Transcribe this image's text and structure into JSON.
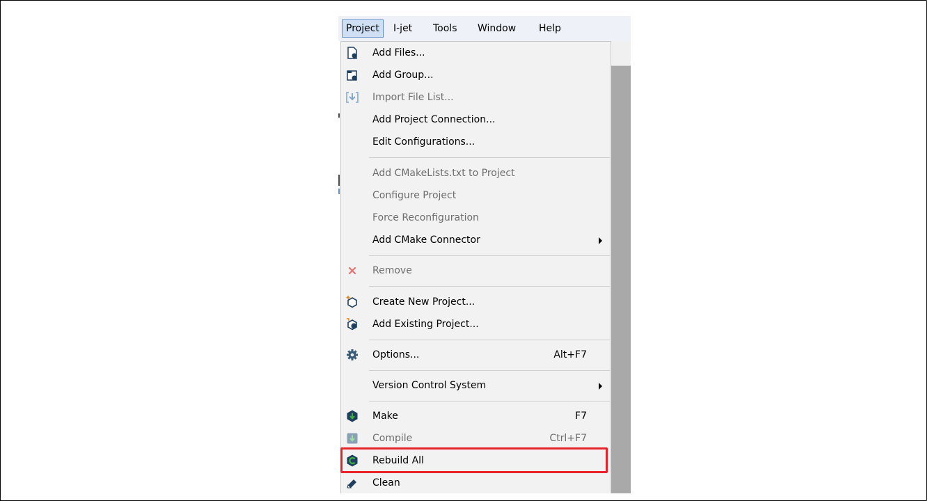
{
  "menubar": {
    "items": [
      "Project",
      "I-jet",
      "Tools",
      "Window",
      "Help"
    ],
    "active": "Project"
  },
  "menu": {
    "items": [
      {
        "label": "Add Files...",
        "shortcut": "",
        "disabled": false,
        "submenu": false,
        "icon": "add-file-icon"
      },
      {
        "label": "Add Group...",
        "shortcut": "",
        "disabled": false,
        "submenu": false,
        "icon": "add-group-icon"
      },
      {
        "label": "Import File List...",
        "shortcut": "",
        "disabled": true,
        "submenu": false,
        "icon": "import-file-list-icon"
      },
      {
        "label": "Add Project Connection...",
        "shortcut": "",
        "disabled": false,
        "submenu": false,
        "icon": ""
      },
      {
        "label": "Edit Configurations...",
        "shortcut": "",
        "disabled": false,
        "submenu": false,
        "icon": ""
      },
      {
        "label": "Add CMakeLists.txt to Project",
        "shortcut": "",
        "disabled": true,
        "submenu": false,
        "icon": ""
      },
      {
        "label": "Configure Project",
        "shortcut": "",
        "disabled": true,
        "submenu": false,
        "icon": ""
      },
      {
        "label": "Force Reconfiguration",
        "shortcut": "",
        "disabled": true,
        "submenu": false,
        "icon": ""
      },
      {
        "label": "Add CMake Connector",
        "shortcut": "",
        "disabled": false,
        "submenu": true,
        "icon": ""
      },
      {
        "label": "Remove",
        "shortcut": "",
        "disabled": true,
        "submenu": false,
        "icon": "remove-x-icon"
      },
      {
        "label": "Create New Project...",
        "shortcut": "",
        "disabled": false,
        "submenu": false,
        "icon": "create-project-icon"
      },
      {
        "label": "Add Existing Project...",
        "shortcut": "",
        "disabled": false,
        "submenu": false,
        "icon": "add-existing-project-icon"
      },
      {
        "label": "Options...",
        "shortcut": "Alt+F7",
        "disabled": false,
        "submenu": false,
        "icon": "gear-icon"
      },
      {
        "label": "Version Control System",
        "shortcut": "",
        "disabled": false,
        "submenu": true,
        "icon": ""
      },
      {
        "label": "Make",
        "shortcut": "F7",
        "disabled": false,
        "submenu": false,
        "icon": "make-icon"
      },
      {
        "label": "Compile",
        "shortcut": "Ctrl+F7",
        "disabled": true,
        "submenu": false,
        "icon": "compile-icon"
      },
      {
        "label": "Rebuild All",
        "shortcut": "",
        "disabled": false,
        "submenu": false,
        "icon": "rebuild-all-icon"
      },
      {
        "label": "Clean",
        "shortcut": "",
        "disabled": false,
        "submenu": false,
        "icon": "clean-eraser-icon"
      }
    ]
  },
  "colors": {
    "highlight_border": "#e8232a",
    "icon_dark": "#1f3f5e",
    "icon_green": "#3cb043",
    "remove_red": "#e57373",
    "gear": "#3a5a78"
  }
}
